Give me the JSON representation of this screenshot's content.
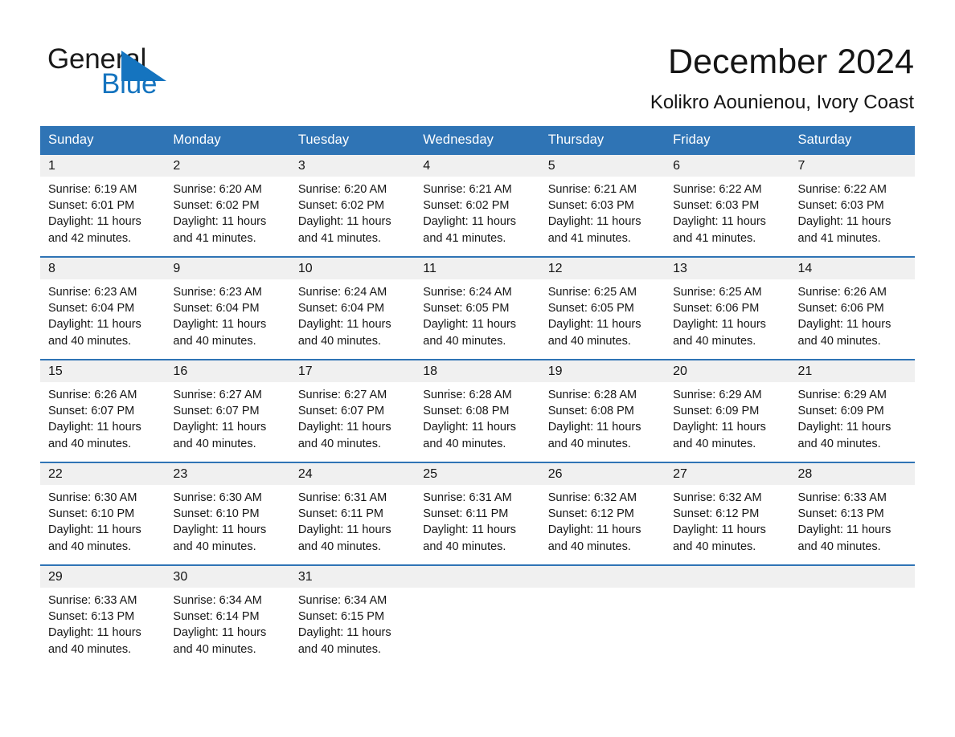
{
  "brand": {
    "name_top": "General",
    "name_bottom": "Blue",
    "triangle_color": "#1574bf",
    "text_color": "#1a1a1a",
    "blue_color": "#1574bf"
  },
  "header": {
    "title": "December 2024",
    "subtitle": "Kolikro Aounienou, Ivory Coast"
  },
  "theme": {
    "header_blue": "#2f74b5",
    "band_gray": "#f0f0f0",
    "text": "#161616"
  },
  "weekdays": [
    "Sunday",
    "Monday",
    "Tuesday",
    "Wednesday",
    "Thursday",
    "Friday",
    "Saturday"
  ],
  "weeks": [
    [
      {
        "day": "1",
        "sunrise": "Sunrise: 6:19 AM",
        "sunset": "Sunset: 6:01 PM",
        "daylight": "Daylight: 11 hours and 42 minutes."
      },
      {
        "day": "2",
        "sunrise": "Sunrise: 6:20 AM",
        "sunset": "Sunset: 6:02 PM",
        "daylight": "Daylight: 11 hours and 41 minutes."
      },
      {
        "day": "3",
        "sunrise": "Sunrise: 6:20 AM",
        "sunset": "Sunset: 6:02 PM",
        "daylight": "Daylight: 11 hours and 41 minutes."
      },
      {
        "day": "4",
        "sunrise": "Sunrise: 6:21 AM",
        "sunset": "Sunset: 6:02 PM",
        "daylight": "Daylight: 11 hours and 41 minutes."
      },
      {
        "day": "5",
        "sunrise": "Sunrise: 6:21 AM",
        "sunset": "Sunset: 6:03 PM",
        "daylight": "Daylight: 11 hours and 41 minutes."
      },
      {
        "day": "6",
        "sunrise": "Sunrise: 6:22 AM",
        "sunset": "Sunset: 6:03 PM",
        "daylight": "Daylight: 11 hours and 41 minutes."
      },
      {
        "day": "7",
        "sunrise": "Sunrise: 6:22 AM",
        "sunset": "Sunset: 6:03 PM",
        "daylight": "Daylight: 11 hours and 41 minutes."
      }
    ],
    [
      {
        "day": "8",
        "sunrise": "Sunrise: 6:23 AM",
        "sunset": "Sunset: 6:04 PM",
        "daylight": "Daylight: 11 hours and 40 minutes."
      },
      {
        "day": "9",
        "sunrise": "Sunrise: 6:23 AM",
        "sunset": "Sunset: 6:04 PM",
        "daylight": "Daylight: 11 hours and 40 minutes."
      },
      {
        "day": "10",
        "sunrise": "Sunrise: 6:24 AM",
        "sunset": "Sunset: 6:04 PM",
        "daylight": "Daylight: 11 hours and 40 minutes."
      },
      {
        "day": "11",
        "sunrise": "Sunrise: 6:24 AM",
        "sunset": "Sunset: 6:05 PM",
        "daylight": "Daylight: 11 hours and 40 minutes."
      },
      {
        "day": "12",
        "sunrise": "Sunrise: 6:25 AM",
        "sunset": "Sunset: 6:05 PM",
        "daylight": "Daylight: 11 hours and 40 minutes."
      },
      {
        "day": "13",
        "sunrise": "Sunrise: 6:25 AM",
        "sunset": "Sunset: 6:06 PM",
        "daylight": "Daylight: 11 hours and 40 minutes."
      },
      {
        "day": "14",
        "sunrise": "Sunrise: 6:26 AM",
        "sunset": "Sunset: 6:06 PM",
        "daylight": "Daylight: 11 hours and 40 minutes."
      }
    ],
    [
      {
        "day": "15",
        "sunrise": "Sunrise: 6:26 AM",
        "sunset": "Sunset: 6:07 PM",
        "daylight": "Daylight: 11 hours and 40 minutes."
      },
      {
        "day": "16",
        "sunrise": "Sunrise: 6:27 AM",
        "sunset": "Sunset: 6:07 PM",
        "daylight": "Daylight: 11 hours and 40 minutes."
      },
      {
        "day": "17",
        "sunrise": "Sunrise: 6:27 AM",
        "sunset": "Sunset: 6:07 PM",
        "daylight": "Daylight: 11 hours and 40 minutes."
      },
      {
        "day": "18",
        "sunrise": "Sunrise: 6:28 AM",
        "sunset": "Sunset: 6:08 PM",
        "daylight": "Daylight: 11 hours and 40 minutes."
      },
      {
        "day": "19",
        "sunrise": "Sunrise: 6:28 AM",
        "sunset": "Sunset: 6:08 PM",
        "daylight": "Daylight: 11 hours and 40 minutes."
      },
      {
        "day": "20",
        "sunrise": "Sunrise: 6:29 AM",
        "sunset": "Sunset: 6:09 PM",
        "daylight": "Daylight: 11 hours and 40 minutes."
      },
      {
        "day": "21",
        "sunrise": "Sunrise: 6:29 AM",
        "sunset": "Sunset: 6:09 PM",
        "daylight": "Daylight: 11 hours and 40 minutes."
      }
    ],
    [
      {
        "day": "22",
        "sunrise": "Sunrise: 6:30 AM",
        "sunset": "Sunset: 6:10 PM",
        "daylight": "Daylight: 11 hours and 40 minutes."
      },
      {
        "day": "23",
        "sunrise": "Sunrise: 6:30 AM",
        "sunset": "Sunset: 6:10 PM",
        "daylight": "Daylight: 11 hours and 40 minutes."
      },
      {
        "day": "24",
        "sunrise": "Sunrise: 6:31 AM",
        "sunset": "Sunset: 6:11 PM",
        "daylight": "Daylight: 11 hours and 40 minutes."
      },
      {
        "day": "25",
        "sunrise": "Sunrise: 6:31 AM",
        "sunset": "Sunset: 6:11 PM",
        "daylight": "Daylight: 11 hours and 40 minutes."
      },
      {
        "day": "26",
        "sunrise": "Sunrise: 6:32 AM",
        "sunset": "Sunset: 6:12 PM",
        "daylight": "Daylight: 11 hours and 40 minutes."
      },
      {
        "day": "27",
        "sunrise": "Sunrise: 6:32 AM",
        "sunset": "Sunset: 6:12 PM",
        "daylight": "Daylight: 11 hours and 40 minutes."
      },
      {
        "day": "28",
        "sunrise": "Sunrise: 6:33 AM",
        "sunset": "Sunset: 6:13 PM",
        "daylight": "Daylight: 11 hours and 40 minutes."
      }
    ],
    [
      {
        "day": "29",
        "sunrise": "Sunrise: 6:33 AM",
        "sunset": "Sunset: 6:13 PM",
        "daylight": "Daylight: 11 hours and 40 minutes."
      },
      {
        "day": "30",
        "sunrise": "Sunrise: 6:34 AM",
        "sunset": "Sunset: 6:14 PM",
        "daylight": "Daylight: 11 hours and 40 minutes."
      },
      {
        "day": "31",
        "sunrise": "Sunrise: 6:34 AM",
        "sunset": "Sunset: 6:15 PM",
        "daylight": "Daylight: 11 hours and 40 minutes."
      },
      {
        "day": "",
        "sunrise": "",
        "sunset": "",
        "daylight": ""
      },
      {
        "day": "",
        "sunrise": "",
        "sunset": "",
        "daylight": ""
      },
      {
        "day": "",
        "sunrise": "",
        "sunset": "",
        "daylight": ""
      },
      {
        "day": "",
        "sunrise": "",
        "sunset": "",
        "daylight": ""
      }
    ]
  ]
}
